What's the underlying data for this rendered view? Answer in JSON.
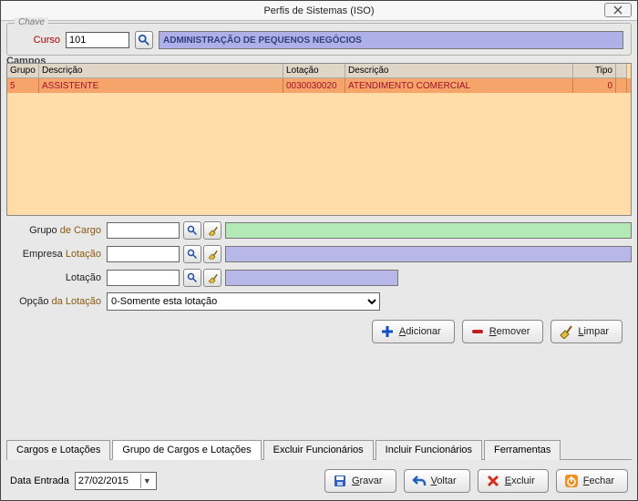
{
  "window": {
    "title": "Perfis de Sistemas (ISO)"
  },
  "chave": {
    "legend": "Chave",
    "curso_label": "Curso",
    "curso_value": "101",
    "descricao": "ADMINISTRAÇÃO DE PEQUENOS NEGÓCIOS"
  },
  "section_label": "Campos",
  "grid": {
    "headers": {
      "grupo": "Grupo",
      "desc1": "Descrição",
      "lot": "Lotação",
      "desc2": "Descrição",
      "tipo": "Tipo"
    },
    "rows": [
      {
        "grupo": "5",
        "desc1": "ASSISTENTE",
        "lot": "0030030020",
        "desc2": "ATENDIMENTO COMERCIAL",
        "tipo": "0"
      }
    ]
  },
  "form": {
    "grupo_cargo_label_pre": "Grupo ",
    "grupo_cargo_label_hl": "de Cargo",
    "empresa_lotacao_label_pre": "Empresa ",
    "empresa_lotacao_label_hl": "Lotação",
    "lotacao_label": "Lotação",
    "opcao_label_pre": "Opção ",
    "opcao_label_hl": "da Lotação",
    "opcao_selected": "0-Somente esta lotação"
  },
  "buttons": {
    "adicionar": "Adicionar",
    "remover": "Remover",
    "limpar": "Limpar"
  },
  "tabs": {
    "cargos": "Cargos e Lotações",
    "grupo": "Grupo de Cargos e Lotações",
    "excluir_func": "Excluir Funcionários",
    "incluir_func": "Incluir Funcionários",
    "ferramentas": "Ferramentas"
  },
  "footer": {
    "data_entrada_label": "Data Entrada",
    "data_entrada_value": "27/02/2015",
    "gravar": "Gravar",
    "voltar": "Voltar",
    "excluir": "Excluir",
    "fechar": "Fechar"
  }
}
